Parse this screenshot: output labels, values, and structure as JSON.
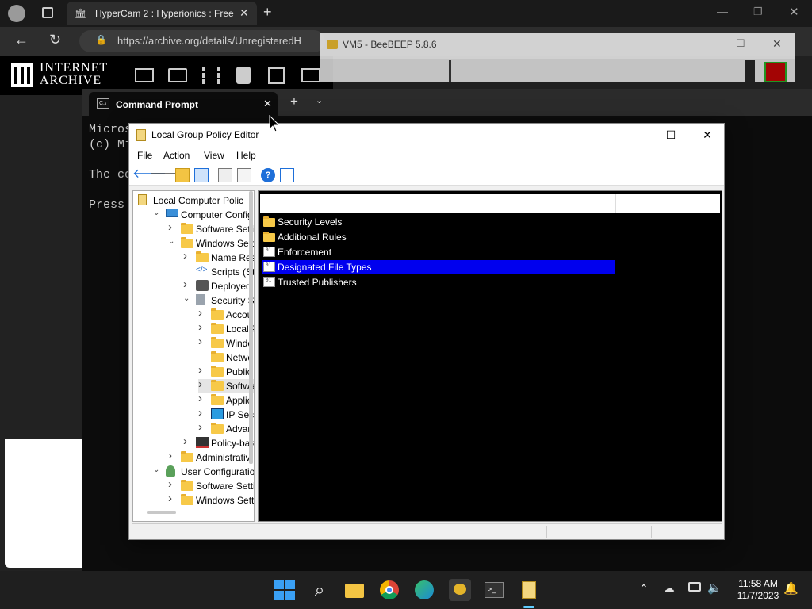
{
  "browser": {
    "tab_title": "HyperCam 2 : Hyperionics : Free",
    "address": "https://archive.org/details/UnregisteredH",
    "logo_line1": "INTERNET",
    "logo_line2": "ARCHIVE"
  },
  "beebeep": {
    "title": "VM5 - BeeBEEP 5.8.6"
  },
  "cmd": {
    "tab_title": "Command Prompt",
    "lines": [
      "Micros",
      "(c) Mi",
      "",
      "The co",
      "",
      "Press "
    ]
  },
  "gpedit": {
    "title": "Local Group Policy Editor",
    "menu": [
      "File",
      "Action",
      "View",
      "Help"
    ],
    "tree": [
      {
        "label": "Local Computer Polic",
        "indent": 0,
        "arrow": "",
        "icon": "policy"
      },
      {
        "label": "Computer Config",
        "indent": 1,
        "arrow": "v",
        "icon": "computer"
      },
      {
        "label": "Software Setti",
        "indent": 2,
        "arrow": ">",
        "icon": "folder"
      },
      {
        "label": "Windows Sett",
        "indent": 2,
        "arrow": "v",
        "icon": "folder"
      },
      {
        "label": "Name Res",
        "indent": 3,
        "arrow": ">",
        "icon": "folder"
      },
      {
        "label": "Scripts (Sta",
        "indent": 3,
        "arrow": "",
        "icon": "script"
      },
      {
        "label": "Deployed",
        "indent": 3,
        "arrow": ">",
        "icon": "printer"
      },
      {
        "label": "Security Se",
        "indent": 3,
        "arrow": "v",
        "icon": "security"
      },
      {
        "label": "Accou",
        "indent": 4,
        "arrow": ">",
        "icon": "folder"
      },
      {
        "label": "Local P",
        "indent": 4,
        "arrow": ">",
        "icon": "folder"
      },
      {
        "label": "Windo",
        "indent": 4,
        "arrow": ">",
        "icon": "folder"
      },
      {
        "label": "Netwo",
        "indent": 4,
        "arrow": "",
        "icon": "folder"
      },
      {
        "label": "Public",
        "indent": 4,
        "arrow": ">",
        "icon": "folder"
      },
      {
        "label": "Softwa",
        "indent": 4,
        "arrow": ">",
        "icon": "folder-open",
        "selected": true
      },
      {
        "label": "Applic",
        "indent": 4,
        "arrow": ">",
        "icon": "folder"
      },
      {
        "label": "IP Secu",
        "indent": 4,
        "arrow": ">",
        "icon": "ipsec"
      },
      {
        "label": "Advan",
        "indent": 4,
        "arrow": ">",
        "icon": "folder"
      },
      {
        "label": "Policy-bas",
        "indent": 3,
        "arrow": ">",
        "icon": "chart"
      },
      {
        "label": "Administrativ",
        "indent": 2,
        "arrow": ">",
        "icon": "folder"
      },
      {
        "label": "User Configuratio",
        "indent": 1,
        "arrow": "v",
        "icon": "user"
      },
      {
        "label": "Software Setti",
        "indent": 2,
        "arrow": ">",
        "icon": "folder"
      },
      {
        "label": "Windows Sett",
        "indent": 2,
        "arrow": ">",
        "icon": "folder"
      }
    ],
    "list": [
      {
        "label": "Security Levels",
        "icon": "folder"
      },
      {
        "label": "Additional Rules",
        "icon": "folder"
      },
      {
        "label": "Enforcement",
        "icon": "doc"
      },
      {
        "label": "Designated File Types",
        "icon": "doc",
        "selected": true
      },
      {
        "label": "Trusted Publishers",
        "icon": "doc"
      }
    ]
  },
  "taskbar": {
    "time": "11:58 AM",
    "date": "11/7/2023"
  }
}
